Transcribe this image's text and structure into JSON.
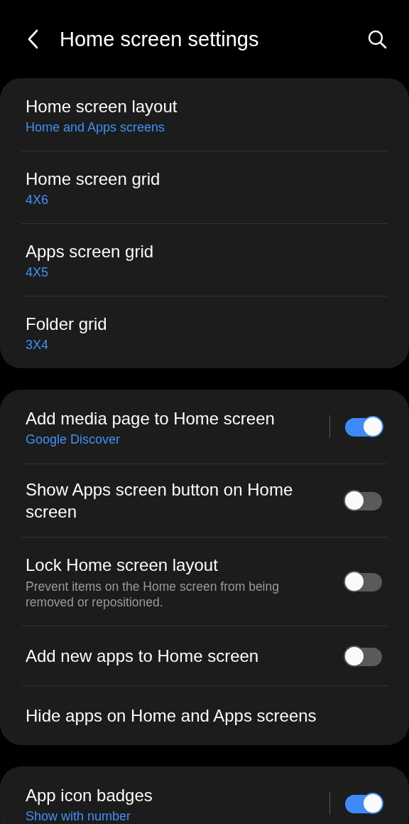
{
  "header": {
    "title": "Home screen settings"
  },
  "groups": [
    {
      "items": [
        {
          "kind": "nav",
          "title": "Home screen layout",
          "summary": "Home and Apps screens"
        },
        {
          "kind": "nav",
          "title": "Home screen grid",
          "summary": "4X6"
        },
        {
          "kind": "nav",
          "title": "Apps screen grid",
          "summary": "4X5"
        },
        {
          "kind": "nav",
          "title": "Folder grid",
          "summary": "3X4"
        }
      ]
    },
    {
      "items": [
        {
          "kind": "switch_link",
          "title": "Add media page to Home screen",
          "summary": "Google Discover",
          "on": true
        },
        {
          "kind": "switch",
          "title": "Show Apps screen button on Home screen",
          "on": false
        },
        {
          "kind": "switch",
          "title": "Lock Home screen layout",
          "description": "Prevent items on the Home screen from being removed or repositioned.",
          "on": false
        },
        {
          "kind": "switch",
          "title": "Add new apps to Home screen",
          "on": false
        },
        {
          "kind": "nav",
          "title": "Hide apps on Home and Apps screens"
        }
      ]
    },
    {
      "items": [
        {
          "kind": "switch_link",
          "title": "App icon badges",
          "summary": "Show with number",
          "on": true
        }
      ]
    }
  ]
}
